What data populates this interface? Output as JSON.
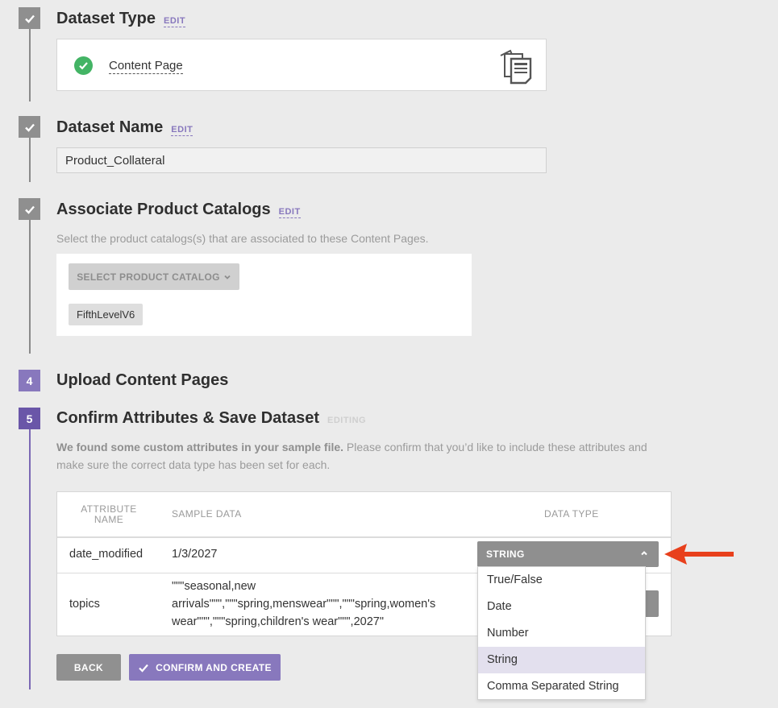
{
  "steps": {
    "dataset_type": {
      "title": "Dataset Type",
      "edit": "EDIT",
      "value": "Content Page",
      "icon": "content-page-doc-icon"
    },
    "dataset_name": {
      "title": "Dataset Name",
      "edit": "EDIT",
      "value": "Product_Collateral"
    },
    "catalogs": {
      "title": "Associate Product Catalogs",
      "edit": "EDIT",
      "description": "Select the product catalogs(s) that are associated to these Content Pages.",
      "select_button": "SELECT PRODUCT CATALOG",
      "selected_tags": [
        "FifthLevelV6"
      ]
    },
    "upload": {
      "number": "4",
      "title": "Upload Content Pages"
    },
    "confirm": {
      "number": "5",
      "title": "Confirm Attributes & Save Dataset",
      "status": "EDITING",
      "description_bold": "We found some custom attributes in your sample file.",
      "description_rest": " Please confirm that you’d like to include these attributes and make sure the correct data type has been set for each."
    }
  },
  "table": {
    "headers": {
      "attribute": "ATTRIBUTE NAME",
      "sample": "SAMPLE DATA",
      "type": "DATA TYPE"
    },
    "rows": [
      {
        "attribute": "date_modified",
        "sample": "1/3/2027",
        "type": "STRING"
      },
      {
        "attribute": "topics",
        "sample": "\"\"\"seasonal,new arrivals\"\"\",\"\"\"spring,menswear\"\"\",\"\"\"spring,women's wear\"\"\",\"\"\"spring,children's wear\"\"\",2027\"",
        "type": "STRING"
      }
    ]
  },
  "dropdown": {
    "options": [
      "True/False",
      "Date",
      "Number",
      "String",
      "Comma Separated String"
    ],
    "selected": "String"
  },
  "buttons": {
    "back": "BACK",
    "confirm": "CONFIRM AND CREATE"
  },
  "colors": {
    "accent": "#8878bd",
    "accent_dark": "#6a56a8",
    "success": "#43b465",
    "arrow": "#e8401c",
    "step_done": "#8f8f8f"
  }
}
